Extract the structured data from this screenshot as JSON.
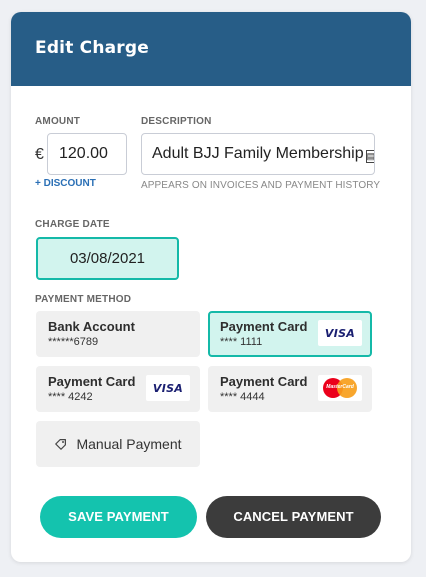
{
  "modal": {
    "title": "Edit Charge"
  },
  "amount": {
    "label": "AMOUNT",
    "currency_symbol": "€",
    "value": "120.00",
    "discount_link": "+ DISCOUNT"
  },
  "description": {
    "label": "DESCRIPTION",
    "value": "Adult BJJ Family Membership",
    "help_text": "APPEARS ON INVOICES AND PAYMENT HISTORY"
  },
  "charge_date": {
    "label": "CHARGE DATE",
    "value": "03/08/2021"
  },
  "payment_method": {
    "label": "PAYMENT METHOD",
    "options": [
      {
        "type": "Bank Account",
        "number": "******6789",
        "logo": "",
        "selected": false
      },
      {
        "type": "Payment Card",
        "number": "**** 1111",
        "logo": "visa",
        "logo_text": "VISA",
        "selected": true
      },
      {
        "type": "Payment Card",
        "number": "**** 4242",
        "logo": "visa",
        "logo_text": "VISA",
        "selected": false
      },
      {
        "type": "Payment Card",
        "number": "**** 4444",
        "logo": "mastercard",
        "logo_text": "MasterCard",
        "selected": false
      }
    ],
    "manual_label": "Manual Payment"
  },
  "actions": {
    "save_label": "SAVE PAYMENT",
    "cancel_label": "CANCEL PAYMENT"
  },
  "colors": {
    "header": "#275d87",
    "accent": "#14c3ae",
    "selected_bg": "#d2f4ee",
    "selected_border": "#14b9a8",
    "cancel": "#3c3c3c",
    "link": "#2a6fb5"
  }
}
